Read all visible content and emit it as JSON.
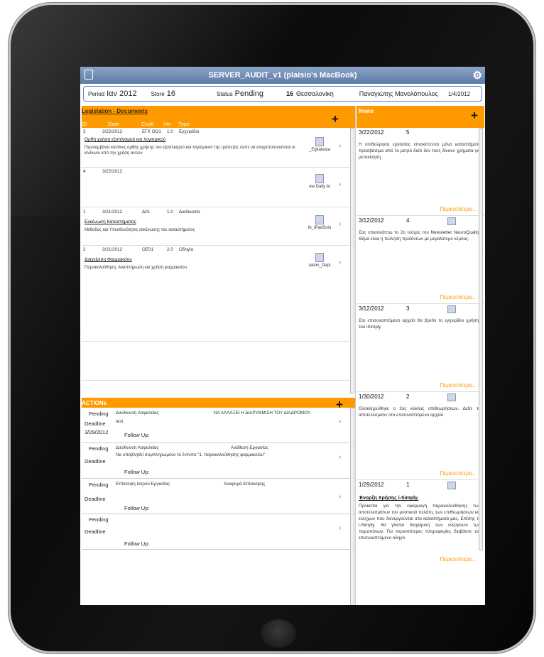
{
  "window": {
    "title": "SERVER_AUDIT_v1 (plaisio's MacBook)"
  },
  "header": {
    "period_label": "Period",
    "period_value": "Ιαν 2012",
    "store_label": "Store",
    "store_value": "16",
    "status_label": "Status",
    "status_value": "Pending",
    "store_num": "16",
    "store_city": "Θεσσαλονίκη",
    "user_name": "Παναγιώτης Μανολόπουλος",
    "date": "1/4/2012"
  },
  "legislation": {
    "title": "Legislation - Documents",
    "columns": [
      "ID",
      "Date",
      "Code",
      "Ver",
      "Type"
    ],
    "rows": [
      {
        "id": "3",
        "date": "3/22/2012",
        "code": "ΕΓΧ ΟΟ1",
        "ver": "1.0",
        "type": "Εγχειρίδιο",
        "link": "Ορθή χρήση εξοπλισμού και λογισμικού",
        "desc": "Περιλαμβάνει κανόνες ορθής χρήσης του εξοπλισμού και λογισμικού της τράπεζας ώστε να ελαχιστοποιούνται οι κίνδυνοι από την χρήση αυτών",
        "file": "_Egkatasta"
      },
      {
        "id": "4",
        "date": "3/22/2012",
        "code": "",
        "ver": "",
        "type": "",
        "link": "",
        "desc": "",
        "file": "ew Daily Al"
      },
      {
        "id": "1",
        "date": "3/21/2012",
        "code": "Δ01",
        "ver": "1.0",
        "type": "Διαδικασία",
        "link": "Εκκένωση Καταστήματος",
        "desc": "Μέθοδος και Υπευθυνότητες εκκένωσης του καταστήματος",
        "file": "fe_iPadSolu"
      },
      {
        "id": "2",
        "date": "3/21/2012",
        "code": "ΟΕ01",
        "ver": "2.0",
        "type": "Οδηγία",
        "link": "Διαχείριση Φαρμακείου",
        "desc": "Παρακολούθηση, Αναπλήρωση και χρήση φαρμακείου",
        "file": "ration_Dept"
      }
    ]
  },
  "actions": {
    "title": "ACTIONs",
    "rows": [
      {
        "status": "Pending",
        "deadline_label": "Deadline",
        "deadline": "3/29/2012",
        "department": "Διεύθυνση Ασφαλείας",
        "subject": "ΝΑ ΑΛΛΑΞΕΙ Η ΔΙΑΡΥΘΜΙΣΗ ΤΟΥ ΔΙΑΔΡΟΜΟΥ",
        "note": "test",
        "followup": "Follow Up:"
      },
      {
        "status": "Pending",
        "deadline_label": "Deadline",
        "deadline": "",
        "department": "Διεύθυνση Ασφαλείας",
        "subject": "Ανάθεση Εργασίας",
        "note": "Να υποβληθεί συμπληρωμένο το έντυπο \"1. παρακολούθησης φαρμακείου\"",
        "followup": "Follow Up:"
      },
      {
        "status": "Pending",
        "deadline_label": "Deadline",
        "deadline": "",
        "department": "Επίσκεψη Ιατρού Εργασίας",
        "subject": "Αναφορά Επίσκεψης",
        "note": "",
        "followup": "Follow Up:"
      },
      {
        "status": "Pending",
        "deadline_label": "Deadline",
        "deadline": "",
        "department": "",
        "subject": "",
        "note": "",
        "followup": "Follow Up:"
      }
    ]
  },
  "news": {
    "title": "News",
    "more_label": "Περισσότερα...",
    "items": [
      {
        "date": "3/22/2012",
        "num": "5",
        "heading": "",
        "text": "Η επιθεώρηση εργασίας επισκέπτεται μόνο καταστήματα προσβάσιμα από το μετρό διότι δεν τους δίνουν χρήματα για μετακίνηση"
      },
      {
        "date": "3/12/2012",
        "num": "4",
        "heading": "",
        "text": "Σας επισυνάπτω το 2ο τεύχος του Newsletter NeuroQuality. Θέμα είναι η πώληση προϊόντων με μεγαλύτερο κέρδος."
      },
      {
        "date": "3/12/2012",
        "num": "3",
        "heading": "",
        "text": "Στο επισυναπτόμενο αρχείο θα βρείτε το εγχειρίδιο χρήσης του iSimply"
      },
      {
        "date": "1/30/2012",
        "num": "2",
        "heading": "",
        "text": "Ολοκληρώθηκε ο 2ος κύκλος επιθεωρήσεων. Δείτε τα αποτελέσματα στο επισυναπτόμενο αρχείο"
      },
      {
        "date": "1/29/2012",
        "num": "1",
        "heading": "Ένορξη Χρήσης i-Simply.",
        "text": "Πρόκειται για την εφαρμογή παρακολούθησης των αποτελεσμάτων του μυστικού πελάτη, των επιθεωρήσεων και ελέγχων που διενεργούνται στα καταστήματά μας. Επίσης το i-Simply, θα γίνεται διαχείριση των ενεργειών των παραπόνων. Για περισσότερες πληροφορίες διαβάστε τον επισυναπτόμενο οδηγό."
      }
    ]
  }
}
